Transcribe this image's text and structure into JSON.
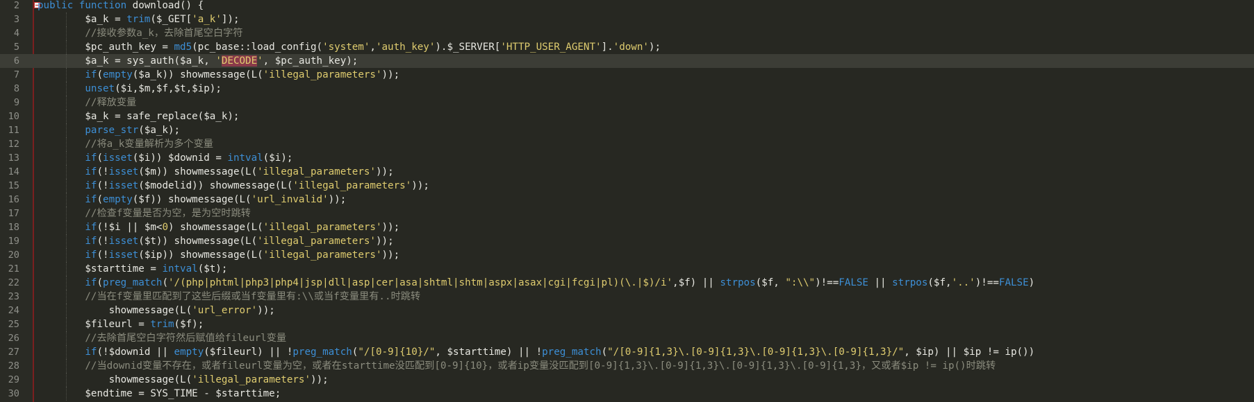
{
  "editor": {
    "lines": [
      {
        "n": "2",
        "fold": true,
        "indent": 0,
        "segs": [
          [
            "kw",
            "public function "
          ],
          [
            "op",
            "download() {"
          ]
        ]
      },
      {
        "n": "3",
        "indent": 2,
        "segs": [
          [
            "op",
            "$a_k = "
          ],
          [
            "fn",
            "trim"
          ],
          [
            "op",
            "($_GET["
          ],
          [
            "str",
            "'a_k'"
          ],
          [
            "op",
            "]);"
          ]
        ]
      },
      {
        "n": "4",
        "indent": 2,
        "segs": [
          [
            "cm",
            "//接收参数a_k，去除首尾空白字符"
          ]
        ]
      },
      {
        "n": "5",
        "indent": 2,
        "segs": [
          [
            "op",
            "$pc_auth_key = "
          ],
          [
            "fn",
            "md5"
          ],
          [
            "op",
            "(pc_base::load_config("
          ],
          [
            "str",
            "'system'"
          ],
          [
            "op",
            ","
          ],
          [
            "str",
            "'auth_key'"
          ],
          [
            "op",
            ").$_SERVER["
          ],
          [
            "str",
            "'HTTP_USER_AGENT'"
          ],
          [
            "op",
            "]."
          ],
          [
            "str",
            "'down'"
          ],
          [
            "op",
            ");"
          ]
        ]
      },
      {
        "n": "6",
        "indent": 2,
        "current": true,
        "segs": [
          [
            "op",
            "$a_k = sys_auth($a_k, "
          ],
          [
            "str",
            "'"
          ],
          [
            "hl",
            "DECODE"
          ],
          [
            "str",
            "'"
          ],
          [
            "op",
            ", $pc_auth_key);"
          ]
        ]
      },
      {
        "n": "7",
        "indent": 2,
        "segs": [
          [
            "kw",
            "if"
          ],
          [
            "op",
            "("
          ],
          [
            "kw",
            "empty"
          ],
          [
            "op",
            "($a_k)) showmessage(L("
          ],
          [
            "str",
            "'illegal_parameters'"
          ],
          [
            "op",
            "));"
          ]
        ]
      },
      {
        "n": "8",
        "indent": 2,
        "segs": [
          [
            "kw",
            "unset"
          ],
          [
            "op",
            "($i,$m,$f,$t,$ip);"
          ]
        ]
      },
      {
        "n": "9",
        "indent": 2,
        "segs": [
          [
            "cm",
            "//释放变量"
          ]
        ]
      },
      {
        "n": "10",
        "indent": 2,
        "segs": [
          [
            "op",
            "$a_k = safe_replace($a_k);"
          ]
        ]
      },
      {
        "n": "11",
        "indent": 2,
        "segs": [
          [
            "fn",
            "parse_str"
          ],
          [
            "op",
            "($a_k);"
          ]
        ]
      },
      {
        "n": "12",
        "indent": 2,
        "segs": [
          [
            "cm",
            "//将a_k变量解析为多个变量"
          ]
        ]
      },
      {
        "n": "13",
        "indent": 2,
        "segs": [
          [
            "kw",
            "if"
          ],
          [
            "op",
            "("
          ],
          [
            "kw",
            "isset"
          ],
          [
            "op",
            "($i)) $downid = "
          ],
          [
            "fn",
            "intval"
          ],
          [
            "op",
            "($i);"
          ]
        ]
      },
      {
        "n": "14",
        "indent": 2,
        "segs": [
          [
            "kw",
            "if"
          ],
          [
            "op",
            "(!"
          ],
          [
            "kw",
            "isset"
          ],
          [
            "op",
            "($m)) showmessage(L("
          ],
          [
            "str",
            "'illegal_parameters'"
          ],
          [
            "op",
            "));"
          ]
        ]
      },
      {
        "n": "15",
        "indent": 2,
        "segs": [
          [
            "kw",
            "if"
          ],
          [
            "op",
            "(!"
          ],
          [
            "kw",
            "isset"
          ],
          [
            "op",
            "($modelid)) showmessage(L("
          ],
          [
            "str",
            "'illegal_parameters'"
          ],
          [
            "op",
            "));"
          ]
        ]
      },
      {
        "n": "16",
        "indent": 2,
        "segs": [
          [
            "kw",
            "if"
          ],
          [
            "op",
            "("
          ],
          [
            "kw",
            "empty"
          ],
          [
            "op",
            "($f)) showmessage(L("
          ],
          [
            "str",
            "'url_invalid'"
          ],
          [
            "op",
            "));"
          ]
        ]
      },
      {
        "n": "17",
        "indent": 2,
        "segs": [
          [
            "cm",
            "//检查f变量是否为空，是为空时跳转"
          ]
        ]
      },
      {
        "n": "18",
        "indent": 2,
        "segs": [
          [
            "kw",
            "if"
          ],
          [
            "op",
            "(!$i || $m<"
          ],
          [
            "str",
            "0"
          ],
          [
            "op",
            ") showmessage(L("
          ],
          [
            "str",
            "'illegal_parameters'"
          ],
          [
            "op",
            "));"
          ]
        ]
      },
      {
        "n": "19",
        "indent": 2,
        "segs": [
          [
            "kw",
            "if"
          ],
          [
            "op",
            "(!"
          ],
          [
            "kw",
            "isset"
          ],
          [
            "op",
            "($t)) showmessage(L("
          ],
          [
            "str",
            "'illegal_parameters'"
          ],
          [
            "op",
            "));"
          ]
        ]
      },
      {
        "n": "20",
        "indent": 2,
        "segs": [
          [
            "kw",
            "if"
          ],
          [
            "op",
            "(!"
          ],
          [
            "kw",
            "isset"
          ],
          [
            "op",
            "($ip)) showmessage(L("
          ],
          [
            "str",
            "'illegal_parameters'"
          ],
          [
            "op",
            "));"
          ]
        ]
      },
      {
        "n": "21",
        "indent": 2,
        "segs": [
          [
            "op",
            "$starttime = "
          ],
          [
            "fn",
            "intval"
          ],
          [
            "op",
            "($t);"
          ]
        ]
      },
      {
        "n": "22",
        "indent": 2,
        "segs": [
          [
            "kw",
            "if"
          ],
          [
            "op",
            "("
          ],
          [
            "fn",
            "preg_match"
          ],
          [
            "op",
            "("
          ],
          [
            "str",
            "'/(php|phtml|php3|php4|jsp|dll|asp|cer|asa|shtml|shtm|aspx|asax|cgi|fcgi|pl)(\\.|$)/i'"
          ],
          [
            "op",
            ",$f) || "
          ],
          [
            "fn",
            "strpos"
          ],
          [
            "op",
            "($f, "
          ],
          [
            "str",
            "\":\\\\\""
          ],
          [
            "op",
            ")!=="
          ],
          [
            "kw",
            "FALSE"
          ],
          [
            "op",
            " || "
          ],
          [
            "fn",
            "strpos"
          ],
          [
            "op",
            "($f,"
          ],
          [
            "str",
            "'..'"
          ],
          [
            "op",
            ")!=="
          ],
          [
            "kw",
            "FALSE"
          ],
          [
            "op",
            ")"
          ]
        ]
      },
      {
        "n": "23",
        "indent": 2,
        "segs": [
          [
            "cm",
            "//当在f变量里匹配到了这些后缀或当f变量里有:\\\\或当f变量里有..时跳转"
          ]
        ]
      },
      {
        "n": "24",
        "indent": 3,
        "segs": [
          [
            "op",
            "showmessage(L("
          ],
          [
            "str",
            "'url_error'"
          ],
          [
            "op",
            "));"
          ]
        ]
      },
      {
        "n": "25",
        "indent": 2,
        "segs": [
          [
            "op",
            "$fileurl = "
          ],
          [
            "fn",
            "trim"
          ],
          [
            "op",
            "($f);"
          ]
        ]
      },
      {
        "n": "26",
        "indent": 2,
        "segs": [
          [
            "cm",
            "//去除首尾空白字符然后赋值给fileurl变量"
          ]
        ]
      },
      {
        "n": "27",
        "indent": 2,
        "segs": [
          [
            "kw",
            "if"
          ],
          [
            "op",
            "(!$downid || "
          ],
          [
            "kw",
            "empty"
          ],
          [
            "op",
            "($fileurl) || !"
          ],
          [
            "fn",
            "preg_match"
          ],
          [
            "op",
            "("
          ],
          [
            "str",
            "\"/[0-9]{10}/\""
          ],
          [
            "op",
            ", $starttime) || !"
          ],
          [
            "fn",
            "preg_match"
          ],
          [
            "op",
            "("
          ],
          [
            "str",
            "\"/[0-9]{1,3}\\.[0-9]{1,3}\\.[0-9]{1,3}\\.[0-9]{1,3}/\""
          ],
          [
            "op",
            ", $ip) || $ip != ip())"
          ]
        ]
      },
      {
        "n": "28",
        "indent": 2,
        "segs": [
          [
            "cm",
            "//当downid变量不存在，或者fileurl变量为空，或者在starttime没匹配到[0-9]{10}，或者ip变量没匹配到[0-9]{1,3}\\.[0-9]{1,3}\\.[0-9]{1,3}\\.[0-9]{1,3}，又或者$ip != ip()时跳转"
          ]
        ]
      },
      {
        "n": "29",
        "indent": 3,
        "segs": [
          [
            "op",
            "showmessage(L("
          ],
          [
            "str",
            "'illegal_parameters'"
          ],
          [
            "op",
            "));"
          ]
        ]
      },
      {
        "n": "30",
        "indent": 2,
        "segs": [
          [
            "op",
            "$endtime = SYS_TIME - $starttime;"
          ]
        ]
      }
    ]
  }
}
